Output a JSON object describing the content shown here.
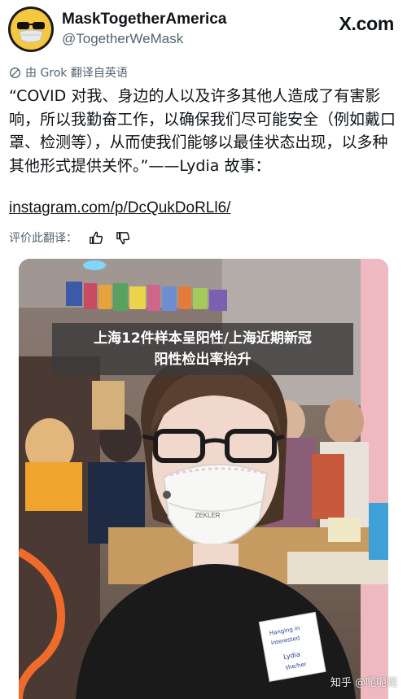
{
  "header": {
    "display_name": "MaskTogetherAmerica",
    "handle": "@TogetherWeMask",
    "brand": "X.com"
  },
  "translation": {
    "label": "由 Grok 翻译自英语"
  },
  "tweet": {
    "text": "“COVID 对我、身边的人以及许多其他人造成了有害影响，所以我勤奋工作，以确保我们尽可能安全（例如戴口罩、检测等），从而使我们能够以最佳状态出现，以多种其他形式提供关怀。”——Lydia 故事：",
    "link": "instagram.com/p/DcQukDoRLl6/"
  },
  "rating": {
    "label": "评价此翻译："
  },
  "media": {
    "mask_brand": "ZEKLER",
    "name_tag_lines": [
      "Hanging in",
      "interested",
      "Lydia",
      "she/her"
    ]
  },
  "caption": {
    "line1": "上海12件样本呈阳性/上海近期新冠",
    "line2": "阳性检出率抬升"
  },
  "watermark": "知乎 @呃呃呃",
  "icons": {
    "avatar": "sunglasses-mask-avatar-icon",
    "translate": "globe-icon",
    "thumbs_up": "thumbs-up-icon",
    "thumbs_down": "thumbs-down-icon"
  }
}
